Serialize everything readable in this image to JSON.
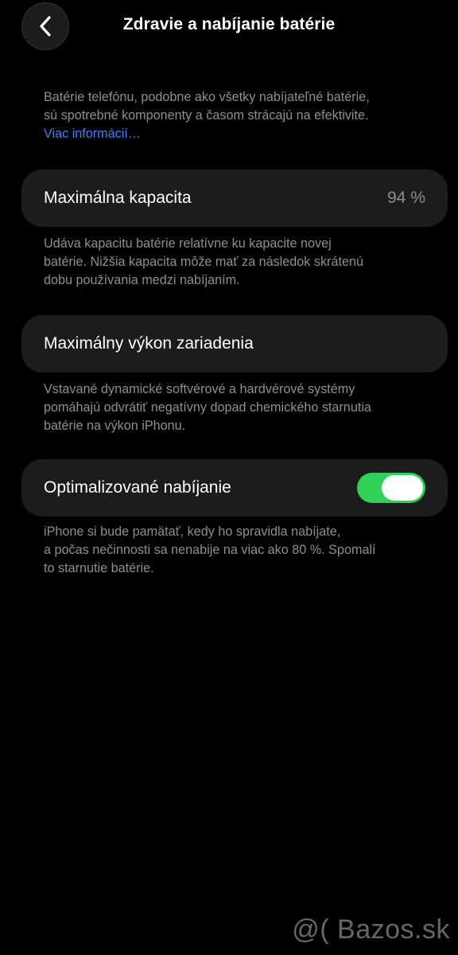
{
  "header": {
    "title": "Zdravie a nabíjanie batérie"
  },
  "intro": {
    "lines": [
      "Batérie telefónu, podobne ako všetky nabíjateľné batérie,",
      "sú spotrebné komponenty a časom strácajú na efektivite."
    ],
    "link": "Viac informácií…"
  },
  "max_capacity": {
    "label": "Maximálna kapacita",
    "value": "94 %",
    "footnote": [
      "Udáva kapacitu batérie relatívne ku kapacite novej",
      "batérie. Nižšia kapacita môže mať za následok skrátenú",
      "dobu používania medzi nabíjaním."
    ]
  },
  "peak_performance": {
    "label": "Maximálny výkon zariadenia",
    "footnote": [
      "Vstavané dynamické softvérové a hardvérové systémy",
      "pomáhajú odvrátiť negatívny dopad chemického starnutia",
      "batérie na výkon iPhonu."
    ]
  },
  "optimized_charging": {
    "label": "Optimalizované nabíjanie",
    "enabled": true,
    "footnote": [
      "iPhone si bude pamätať, kedy ho spravidla nabíjate,",
      "a počas nečinnosti sa nenabije na viac ako 80 %. Spomalí",
      "to starnutie batérie."
    ]
  },
  "watermark": "@( Bazos.sk",
  "colors": {
    "background": "#000000",
    "card": "#1c1c1e",
    "secondary_text": "#8e8e93",
    "link": "#3b82f6",
    "toggle_on": "#30d158"
  },
  "icons": {
    "back": "chevron-left-icon"
  }
}
